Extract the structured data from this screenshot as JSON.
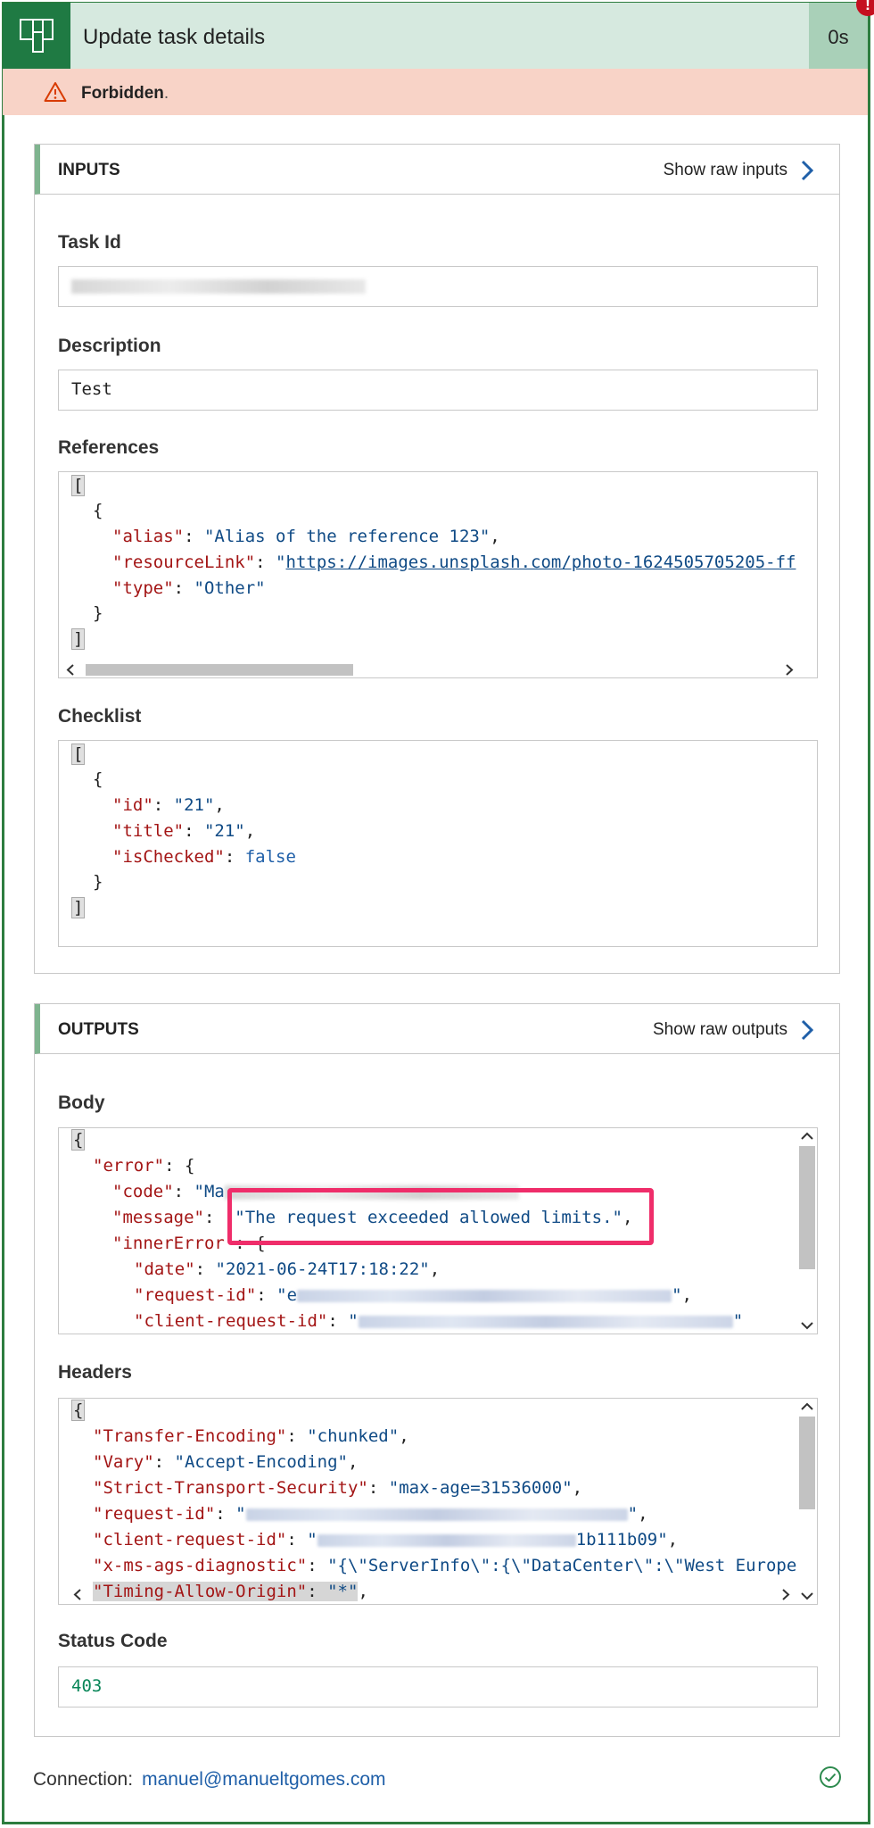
{
  "header": {
    "title": "Update task details",
    "duration": "0s",
    "error_mark": "!"
  },
  "banner": {
    "status": "Forbidden",
    "dot": "."
  },
  "inputs": {
    "heading": "INPUTS",
    "raw_label": "Show raw inputs",
    "task_id": {
      "label": "Task Id"
    },
    "description": {
      "label": "Description",
      "value": "Test"
    },
    "references": {
      "label": "References",
      "open_bracket": "[",
      "open_brace": "{",
      "alias_key": "\"alias\"",
      "alias_value": "\"Alias of the reference 123\"",
      "resource_key": "\"resourceLink\"",
      "resource_quote": "\"",
      "resource_value": "https://images.unsplash.com/photo-1624505705205-ff",
      "type_key": "\"type\"",
      "type_value": "\"Other\"",
      "close_brace": "}",
      "close_bracket": "]"
    },
    "checklist": {
      "label": "Checklist",
      "open_bracket": "[",
      "open_brace": "{",
      "id_key": "\"id\"",
      "id_value": "\"21\"",
      "title_key": "\"title\"",
      "title_value": "\"21\"",
      "checked_key": "\"isChecked\"",
      "checked_value": "false",
      "close_brace": "}",
      "close_bracket": "]"
    }
  },
  "outputs": {
    "heading": "OUTPUTS",
    "raw_label": "Show raw outputs",
    "body": {
      "label": "Body",
      "open_brace": "{",
      "error_key": "\"error\"",
      "code_key": "\"code\"",
      "code_value_start": "\"Ma",
      "message_key": "\"message\"",
      "message_value": "\"The request exceeded allowed limits.\"",
      "inner_key": "\"innerError",
      "date_key": "\"date\"",
      "date_value": "\"2021-06-24T17:18:22\"",
      "request_key": "\"request-id\"",
      "request_value_start": "\"e",
      "client_key": "\"client-request-id\"",
      "client_value_start": "\""
    },
    "headers": {
      "label": "Headers",
      "open_brace": "{",
      "te_key": "\"Transfer-Encoding\"",
      "te_value": "\"chunked\"",
      "vary_key": "\"Vary\"",
      "vary_value": "\"Accept-Encoding\"",
      "sts_key": "\"Strict-Transport-Security\"",
      "sts_value": "\"max-age=31536000\"",
      "req_key": "\"request-id\"",
      "req_value_start": "\"",
      "client_key": "\"client-request-id\"",
      "client_value_start": "\"",
      "client_value_end": "1b111b09\"",
      "diag_key": "\"x-ms-ags-diagnostic\"",
      "diag_value": "\"{\\\"ServerInfo\\\":{\\\"DataCenter\\\":\\\"West Europe",
      "timing_key": "\"Timing-Allow-Origin\"",
      "timing_value": "\"*\""
    },
    "status": {
      "label": "Status Code",
      "value": "403"
    }
  },
  "footer": {
    "connection_label": "Connection:",
    "connection_value": "manuel@manueltgomes.com"
  }
}
